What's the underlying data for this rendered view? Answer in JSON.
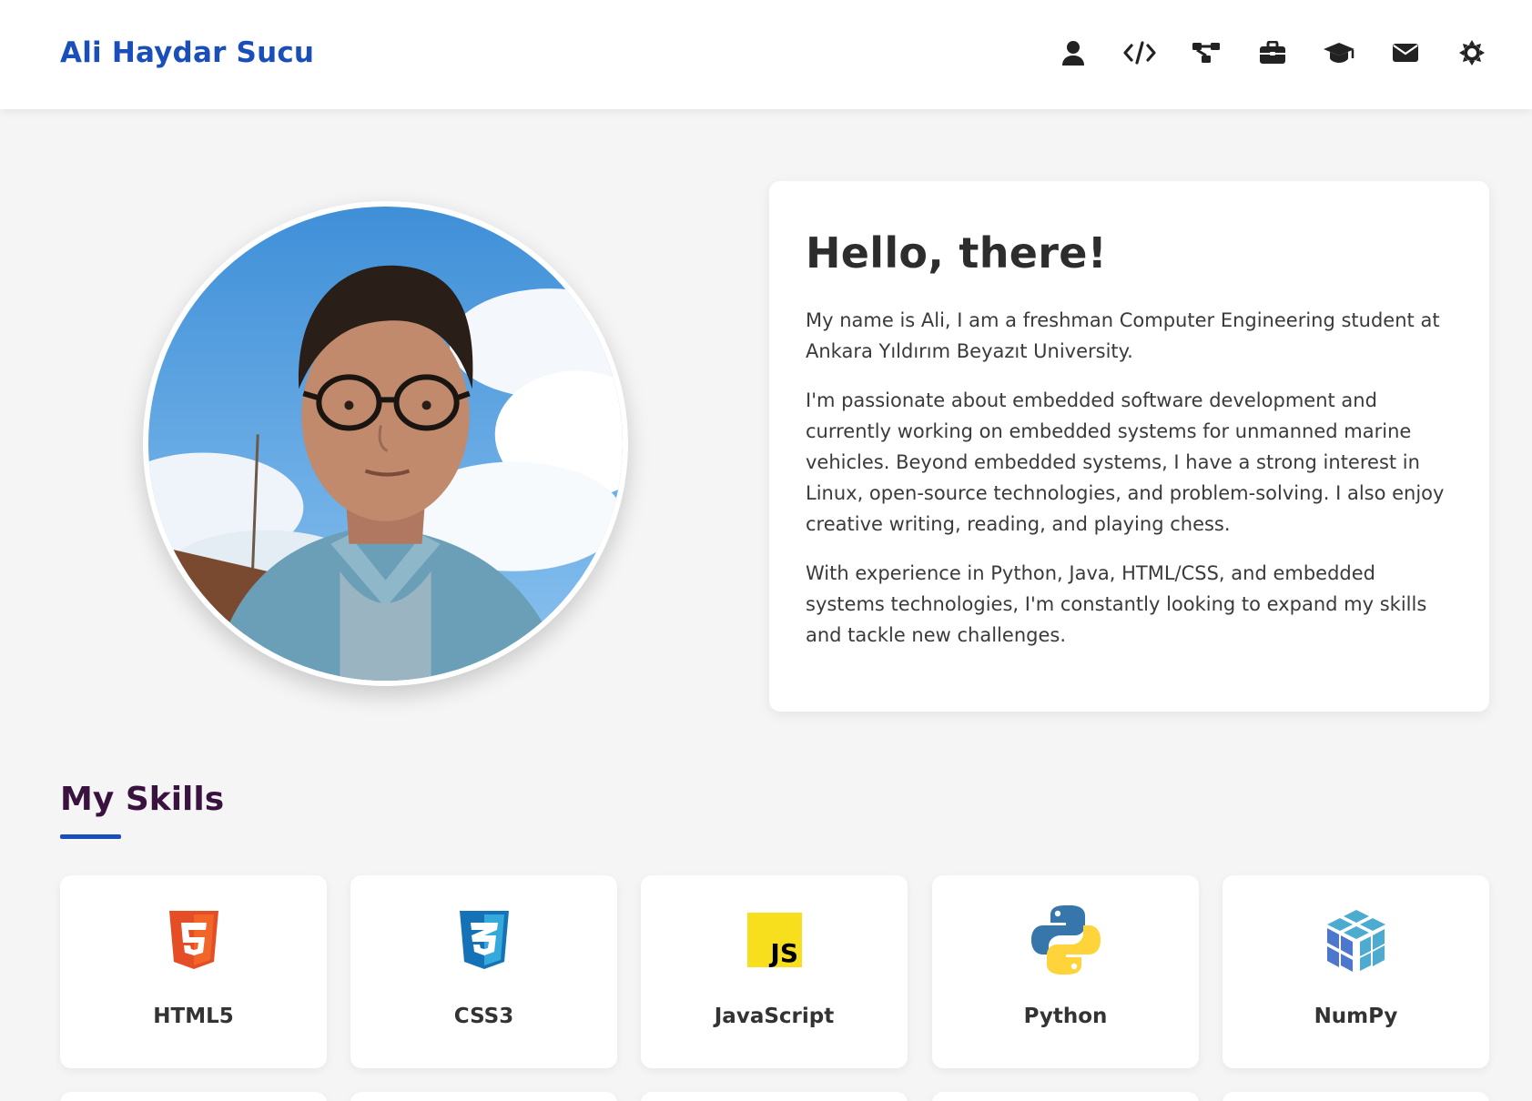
{
  "header": {
    "brand": "Ali Haydar Sucu",
    "nav": [
      {
        "icon": "user-icon"
      },
      {
        "icon": "code-icon"
      },
      {
        "icon": "project-diagram-icon"
      },
      {
        "icon": "briefcase-icon"
      },
      {
        "icon": "graduation-cap-icon"
      },
      {
        "icon": "envelope-icon"
      },
      {
        "icon": "theme-toggle-icon"
      }
    ]
  },
  "about": {
    "title": "Hello, there!",
    "paragraphs": [
      "My name is Ali, I am a freshman Computer Engineering student at Ankara Yıldırım Beyazıt University.",
      "I'm passionate about embedded software development and currently working on embedded systems for unmanned marine vehicles. Beyond embedded systems, I have a strong interest in Linux, open-source technologies, and problem-solving. I also enjoy creative writing, reading, and playing chess.",
      "With experience in Python, Java, HTML/CSS, and embedded systems technologies, I'm constantly looking to expand my skills and tackle new challenges."
    ]
  },
  "skills": {
    "title": "My Skills",
    "items": [
      {
        "name": "HTML5",
        "icon": "html5-icon"
      },
      {
        "name": "CSS3",
        "icon": "css3-icon"
      },
      {
        "name": "JavaScript",
        "icon": "javascript-icon"
      },
      {
        "name": "Python",
        "icon": "python-icon"
      },
      {
        "name": "NumPy",
        "icon": "numpy-icon"
      }
    ]
  },
  "colors": {
    "brand": "#1a4fba",
    "skills_title": "#3a1240",
    "background": "#f5f5f5"
  }
}
